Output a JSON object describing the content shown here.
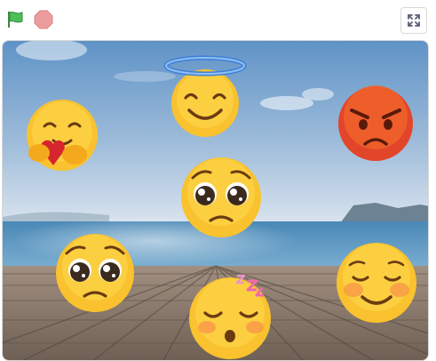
{
  "toolbar": {
    "green_flag": {
      "icon": "green-flag-icon",
      "color": "#4cbf56"
    },
    "stop": {
      "icon": "stop-icon",
      "color": "#ec9c9c"
    },
    "fullscreen": {
      "icon": "fullscreen-icon"
    }
  },
  "stage": {
    "backdrop": "beach-pier",
    "colors": {
      "sky_top": "#5f93c7",
      "sky_bottom": "#cfdceb",
      "sea": "#3f86b4",
      "deck": "#8b7b6d"
    },
    "sprites": [
      {
        "name": "emoji-hugging",
        "icon": "hugging-face-icon"
      },
      {
        "name": "emoji-angel",
        "icon": "smiling-face-with-halo-icon"
      },
      {
        "name": "emoji-angry",
        "icon": "angry-face-icon"
      },
      {
        "name": "emoji-pleading-center",
        "icon": "pleading-face-icon"
      },
      {
        "name": "emoji-pleading-left",
        "icon": "pleading-face-icon"
      },
      {
        "name": "emoji-sleepy",
        "icon": "sleeping-face-icon"
      },
      {
        "name": "emoji-blushing",
        "icon": "smiling-blushing-face-icon"
      }
    ]
  }
}
